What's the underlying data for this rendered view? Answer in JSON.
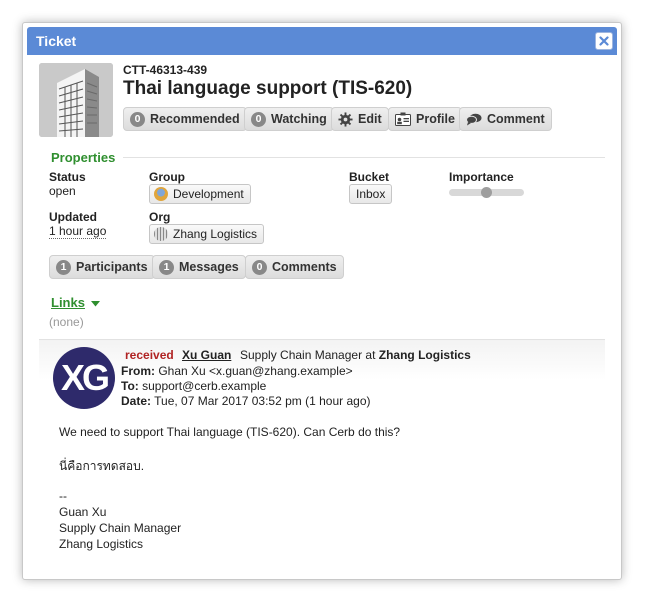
{
  "dialog": {
    "title": "Ticket"
  },
  "ticket": {
    "mask": "CTT-46313-439",
    "subject": "Thai language support (TIS-620)"
  },
  "toolbar": {
    "recommended_count": "0",
    "recommended_label": "Recommended",
    "watching_count": "0",
    "watching_label": "Watching",
    "edit_label": "Edit",
    "profile_label": "Profile",
    "comment_label": "Comment"
  },
  "properties": {
    "heading": "Properties",
    "status_label": "Status",
    "status_value": "open",
    "group_label": "Group",
    "group_value": "Development",
    "bucket_label": "Bucket",
    "bucket_value": "Inbox",
    "importance_label": "Importance",
    "importance_level": 0.5,
    "updated_label": "Updated",
    "updated_value": "1 hour ago",
    "org_label": "Org",
    "org_value": "Zhang Logistics"
  },
  "counts": {
    "participants_count": "1",
    "participants_label": "Participants",
    "messages_count": "1",
    "messages_label": "Messages",
    "comments_count": "0",
    "comments_label": "Comments"
  },
  "links": {
    "heading": "Links",
    "empty": "(none)"
  },
  "message": {
    "avatar_initials": "XG",
    "status": "received",
    "sender_name": "Xu Guan",
    "sender_title": "Supply Chain Manager at",
    "sender_org": "Zhang Logistics",
    "from_label": "From:",
    "from_value": "Ghan Xu <x.guan@zhang.example>",
    "to_label": "To:",
    "to_value": "support@cerb.example",
    "date_label": "Date:",
    "date_value": "Tue, 07 Mar 2017 03:52 pm (1 hour ago)",
    "body": [
      "We need to support Thai language (TIS-620). Can Cerb do this?",
      "นี่คือการทดสอบ.",
      "--",
      "Guan Xu",
      "Supply Chain Manager",
      "Zhang Logistics"
    ]
  },
  "colors": {
    "titlebar": "#5b8ad6",
    "section_heading": "#2f8f2f",
    "received": "#b02323",
    "avatar_bg": "#2e2a6b"
  },
  "icons": {
    "close": "close-icon",
    "edit": "gear-icon",
    "profile": "id-card-icon",
    "comment": "speech-bubble-icon",
    "links_caret": "chevron-down-icon"
  }
}
